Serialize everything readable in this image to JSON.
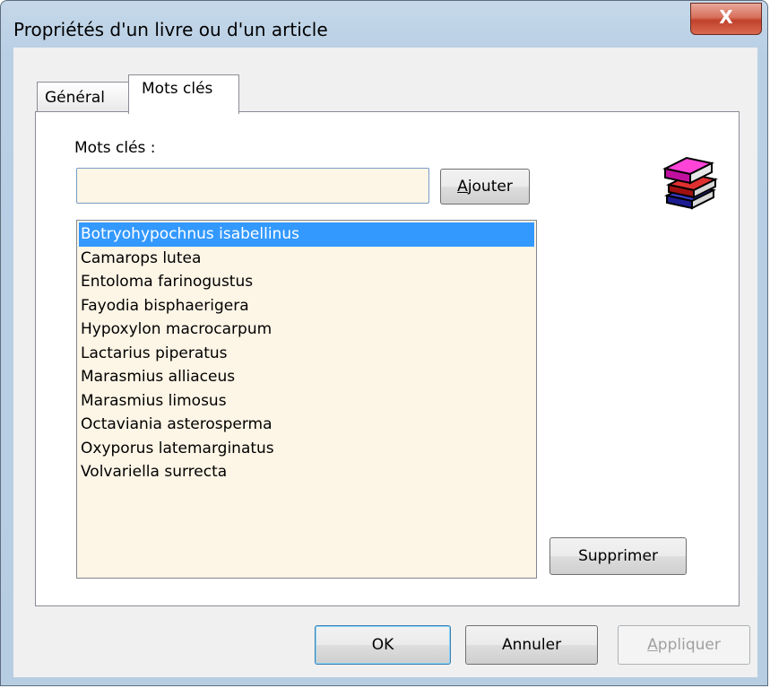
{
  "window": {
    "title": "Propriétés d'un livre ou d'un article",
    "close_label": "X"
  },
  "tabs": [
    {
      "label": "Général",
      "active": false
    },
    {
      "label": "Mots clés",
      "active": true
    }
  ],
  "keywords": {
    "label": "Mots clés :",
    "input_value": "",
    "add_button": {
      "accel": "A",
      "rest": "jouter"
    },
    "items": [
      "Botryohypochnus isabellinus",
      "Camarops lutea",
      "Entoloma farinogustus",
      "Fayodia bisphaerigera",
      "Hypoxylon macrocarpum",
      "Lactarius piperatus",
      "Marasmius alliaceus",
      "Marasmius limosus",
      "Octaviania asterosperma",
      "Oxyporus latemarginatus",
      "Volvariella surrecta"
    ],
    "selected_index": 0,
    "delete_button": "Supprimer",
    "icon": "books-icon"
  },
  "footer": {
    "ok": "OK",
    "cancel": "Annuler",
    "apply": {
      "accel": "A",
      "rest": "ppliquer"
    }
  },
  "colors": {
    "selection": "#3399ff",
    "field_background": "#fdf5e6"
  }
}
